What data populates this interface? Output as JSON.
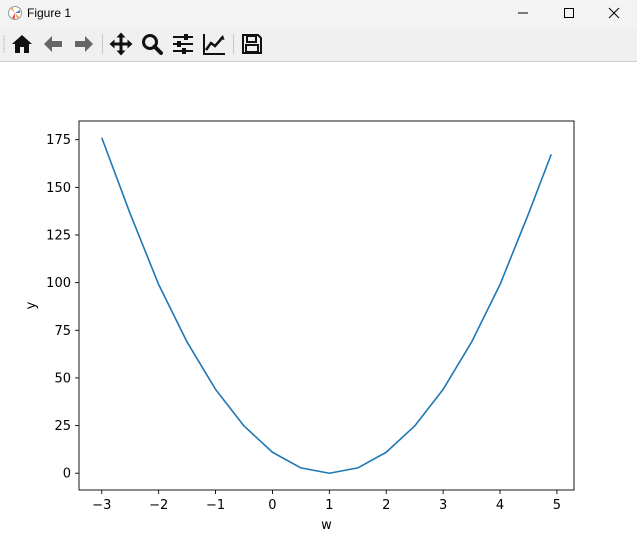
{
  "window": {
    "title": "Figure 1",
    "icon": "matplotlib-icon"
  },
  "window_controls": [
    {
      "name": "minimize-icon"
    },
    {
      "name": "maximize-icon"
    },
    {
      "name": "close-icon"
    }
  ],
  "toolbar": {
    "buttons": [
      {
        "icon": "home-icon",
        "action": "home"
      },
      {
        "icon": "back-arrow-icon",
        "action": "back"
      },
      {
        "icon": "forward-arrow-icon",
        "action": "forward"
      },
      {
        "icon": "pan-icon",
        "action": "pan"
      },
      {
        "icon": "zoom-icon",
        "action": "zoom"
      },
      {
        "icon": "subplots-config-icon",
        "action": "configure subplots"
      },
      {
        "icon": "edit-axis-icon",
        "action": "edit curve"
      },
      {
        "icon": "save-icon",
        "action": "save"
      }
    ]
  },
  "chart_data": {
    "type": "line",
    "title": "",
    "xlabel": "w",
    "ylabel": "y",
    "xlim": [
      -3.4,
      5.3
    ],
    "ylim": [
      -8.8,
      184.8
    ],
    "x_ticks": [
      -3,
      -2,
      -1,
      0,
      1,
      2,
      3,
      4,
      5
    ],
    "x_tick_labels": [
      "−3",
      "−2",
      "−1",
      "0",
      "1",
      "2",
      "3",
      "4",
      "5"
    ],
    "y_ticks": [
      0,
      25,
      50,
      75,
      100,
      125,
      150,
      175
    ],
    "y_tick_labels": [
      "0",
      "25",
      "50",
      "75",
      "100",
      "125",
      "150",
      "175"
    ],
    "grid": false,
    "series": [
      {
        "color": "#1f77b4",
        "x": [
          -3.0,
          -2.5,
          -2.0,
          -1.5,
          -1.0,
          -0.5,
          0.0,
          0.5,
          1.0,
          1.5,
          2.0,
          2.5,
          3.0,
          3.5,
          4.0,
          4.5,
          4.9
        ],
        "y": [
          176.0,
          136.1,
          99.0,
          68.8,
          44.0,
          24.8,
          11.0,
          2.8,
          0.0,
          2.8,
          11.0,
          24.8,
          44.0,
          68.8,
          99.0,
          136.1,
          167.3
        ]
      }
    ]
  }
}
